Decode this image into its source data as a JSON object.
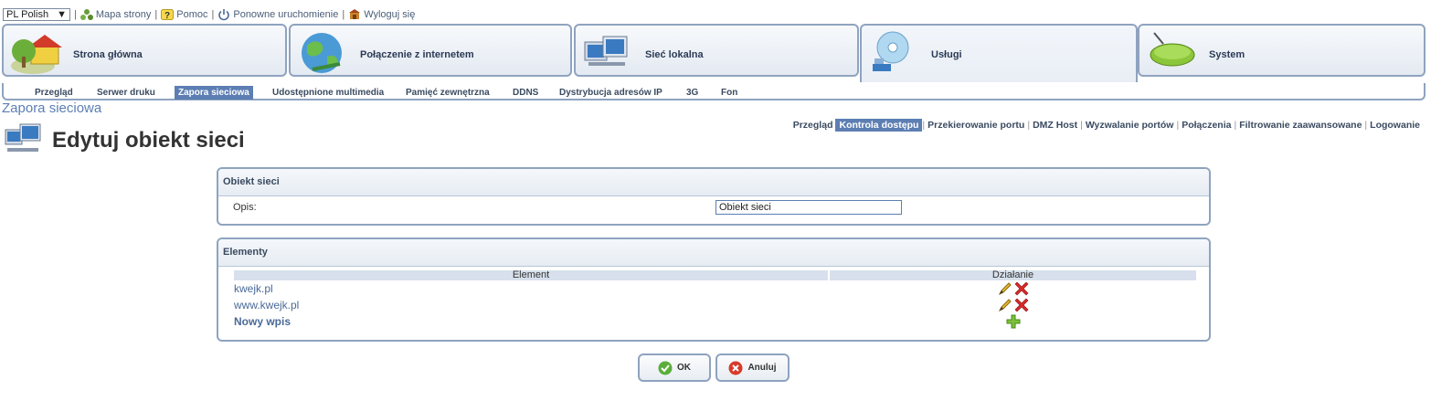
{
  "topbar": {
    "language": "PL Polish",
    "links": [
      "Mapa strony",
      "Pomoc",
      "Ponowne uruchomienie",
      "Wyloguj się"
    ],
    "separator": "|"
  },
  "main_tabs": [
    {
      "label": "Strona główna",
      "icon": "home-icon"
    },
    {
      "label": "Połączenie z internetem",
      "icon": "globe-icon"
    },
    {
      "label": "Sieć lokalna",
      "icon": "network-icon"
    },
    {
      "label": "Usługi",
      "icon": "services-icon"
    },
    {
      "label": "System",
      "icon": "router-icon"
    }
  ],
  "sub_tabs": [
    "Przegląd",
    "Serwer druku",
    "Zapora sieciowa",
    "Udostępnione multimedia",
    "Pamięć zewnętrzna",
    "DDNS",
    "Dystrybucja adresów IP",
    "3G",
    "Fon"
  ],
  "active_sub_tab": "Zapora sieciowa",
  "section_title": "Zapora sieciowa",
  "page_title": "Edytuj obiekt sieci",
  "right_nav": [
    "Przegląd",
    "Kontrola dostępu",
    "Przekierowanie portu",
    "DMZ Host",
    "Wyzwalanie portów",
    "Połączenia",
    "Filtrowanie zaawansowane",
    "Logowanie"
  ],
  "active_right_nav": "Kontrola dostępu",
  "object_panel": {
    "title": "Obiekt sieci",
    "field_label": "Opis:",
    "field_value": "Obiekt sieci"
  },
  "elements_panel": {
    "title": "Elementy",
    "col_element": "Element",
    "col_action": "Działanie",
    "rows": [
      "kwejk.pl",
      "www.kwejk.pl"
    ],
    "new_entry": "Nowy wpis"
  },
  "buttons": {
    "ok": "OK",
    "cancel": "Anuluj"
  },
  "colors": {
    "accent": "#5c7eb3",
    "border": "#8fa3bf",
    "link": "#4a6a98"
  }
}
